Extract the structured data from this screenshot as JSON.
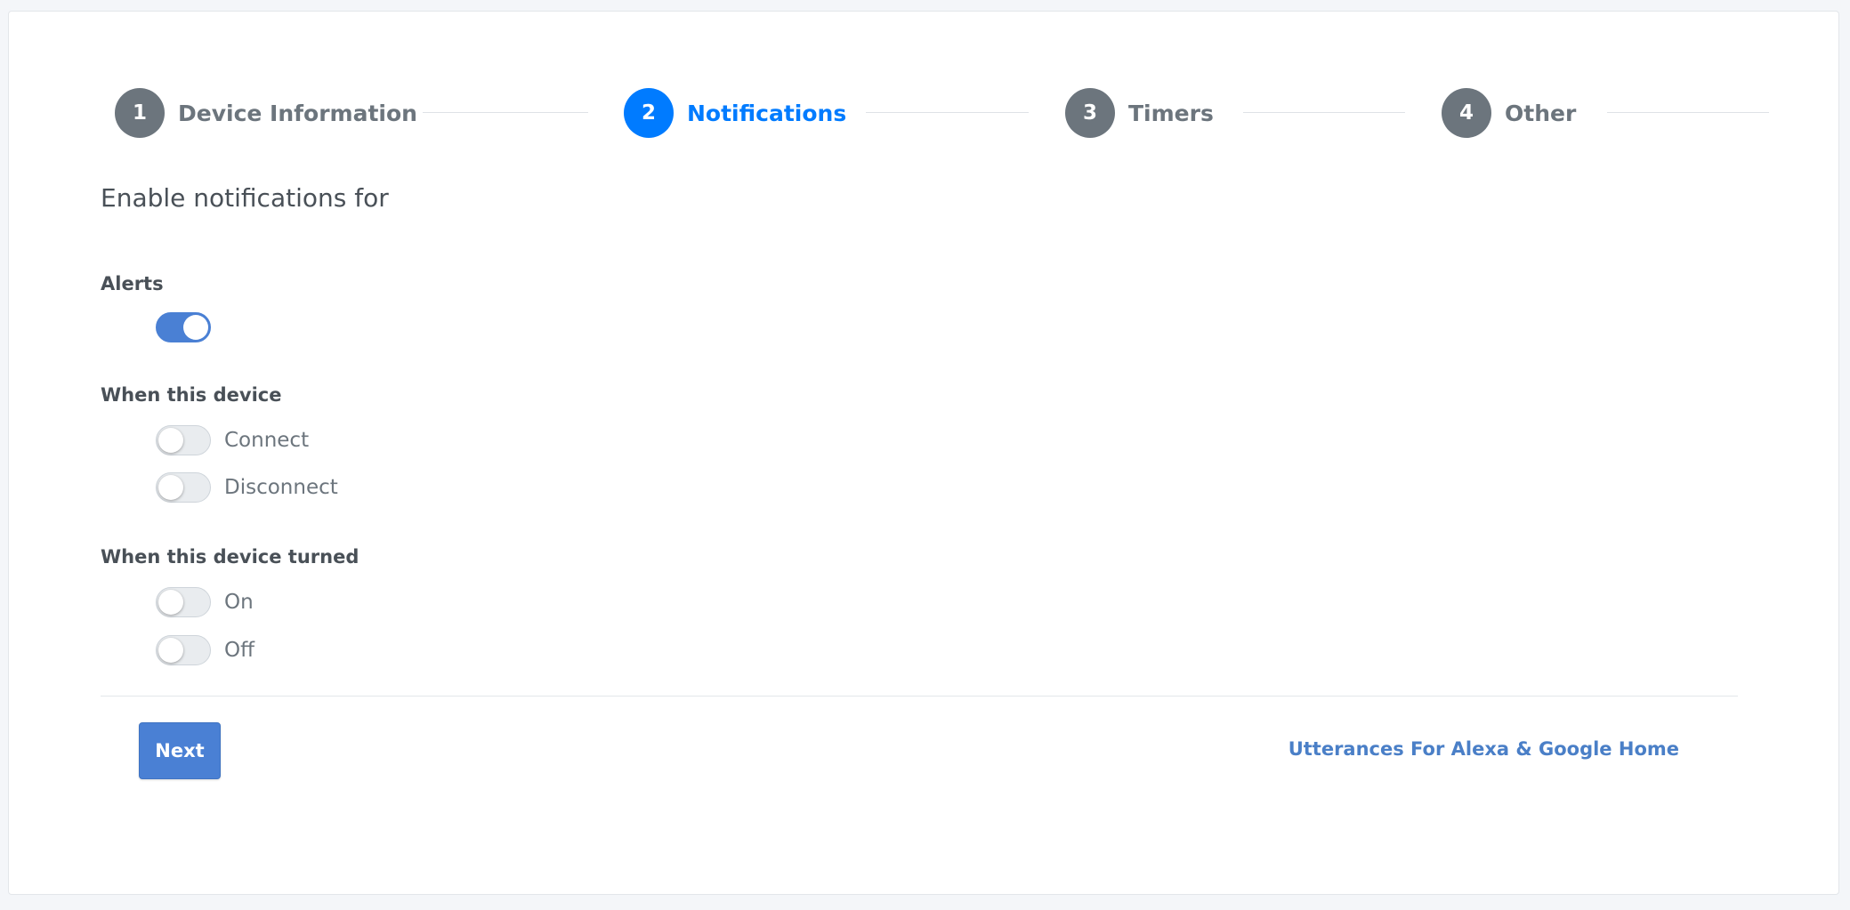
{
  "stepper": {
    "steps": [
      {
        "number": "1",
        "label": "Device Information",
        "active": false
      },
      {
        "number": "2",
        "label": "Notifications",
        "active": true
      },
      {
        "number": "3",
        "label": "Timers",
        "active": false
      },
      {
        "number": "4",
        "label": "Other",
        "active": false
      }
    ]
  },
  "form": {
    "title": "Enable notifications for",
    "alerts": {
      "label": "Alerts",
      "enabled": true
    },
    "device_connection": {
      "label": "When this device",
      "options": [
        {
          "label": "Connect",
          "enabled": false
        },
        {
          "label": "Disconnect",
          "enabled": false
        }
      ]
    },
    "device_power": {
      "label": "When this device turned",
      "options": [
        {
          "label": "On",
          "enabled": false
        },
        {
          "label": "Off",
          "enabled": false
        }
      ]
    }
  },
  "footer": {
    "next_label": "Next",
    "utterances_link": "Utterances For Alexa & Google Home"
  },
  "colors": {
    "primary": "#007bff",
    "toggle_on": "#4a80d4",
    "step_inactive": "#6c757d"
  }
}
